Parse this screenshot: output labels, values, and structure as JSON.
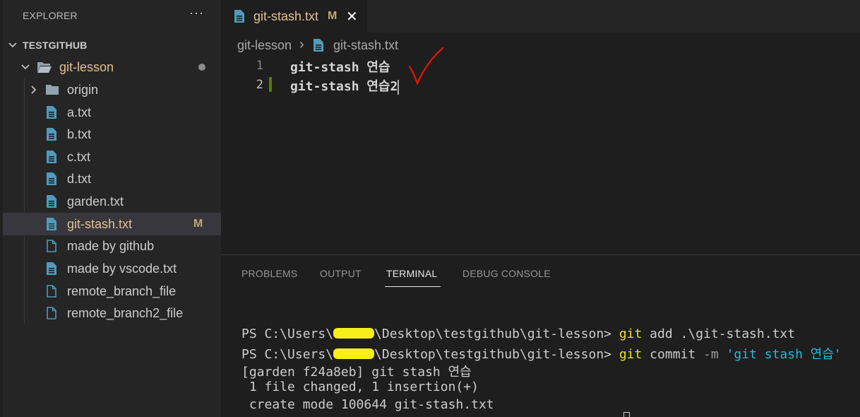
{
  "sidebar": {
    "title": "EXPLORER",
    "more_label": "···",
    "root": "TESTGITHUB",
    "folder": "git-lesson",
    "items": [
      {
        "label": "origin",
        "type": "folder"
      },
      {
        "label": "a.txt",
        "type": "file"
      },
      {
        "label": "b.txt",
        "type": "file"
      },
      {
        "label": "c.txt",
        "type": "file"
      },
      {
        "label": "d.txt",
        "type": "file"
      },
      {
        "label": "garden.txt",
        "type": "file"
      },
      {
        "label": "git-stash.txt",
        "type": "file",
        "badge": "M"
      },
      {
        "label": "made by github",
        "type": "file-outline"
      },
      {
        "label": "made by vscode.txt",
        "type": "file"
      },
      {
        "label": "remote_branch_file",
        "type": "file-outline"
      },
      {
        "label": "remote_branch2_file",
        "type": "file-outline"
      }
    ]
  },
  "editor": {
    "tab": {
      "label": "git-stash.txt",
      "badge": "M",
      "close": "✕"
    },
    "breadcrumb": {
      "folder": "git-lesson",
      "separator": "›",
      "file": "git-stash.txt"
    },
    "lines": [
      {
        "number": "1",
        "text": "git-stash 연습"
      },
      {
        "number": "2",
        "text": "git-stash 연습2"
      }
    ]
  },
  "panel": {
    "tabs": [
      "PROBLEMS",
      "OUTPUT",
      "TERMINAL",
      "DEBUG CONSOLE"
    ],
    "active_tab": "TERMINAL",
    "terminal": {
      "line1_prefix": "PS C:\\Users\\",
      "line1_path": "\\Desktop\\testgithub\\git-lesson> ",
      "line1_cmd": "git",
      "line1_args": " add .\\git-stash.txt",
      "line2_prefix": "PS C:\\Users\\",
      "line2_path": "\\Desktop\\testgithub\\git-lesson> ",
      "line2_cmd": "git",
      "line2_args": " commit ",
      "line2_flag": "-m",
      "line2_msg": " 'git stash 연습'",
      "line3": "[garden f24a8eb] git stash 연습",
      "line4": " 1 file changed, 1 insertion(+)",
      "line5": " create mode 100644 git-stash.txt"
    }
  },
  "colors": {
    "modified": "#e2c08d",
    "file_icon": "#519aba",
    "checkmark": "#e51400",
    "redaction": "#f8ee1a"
  }
}
